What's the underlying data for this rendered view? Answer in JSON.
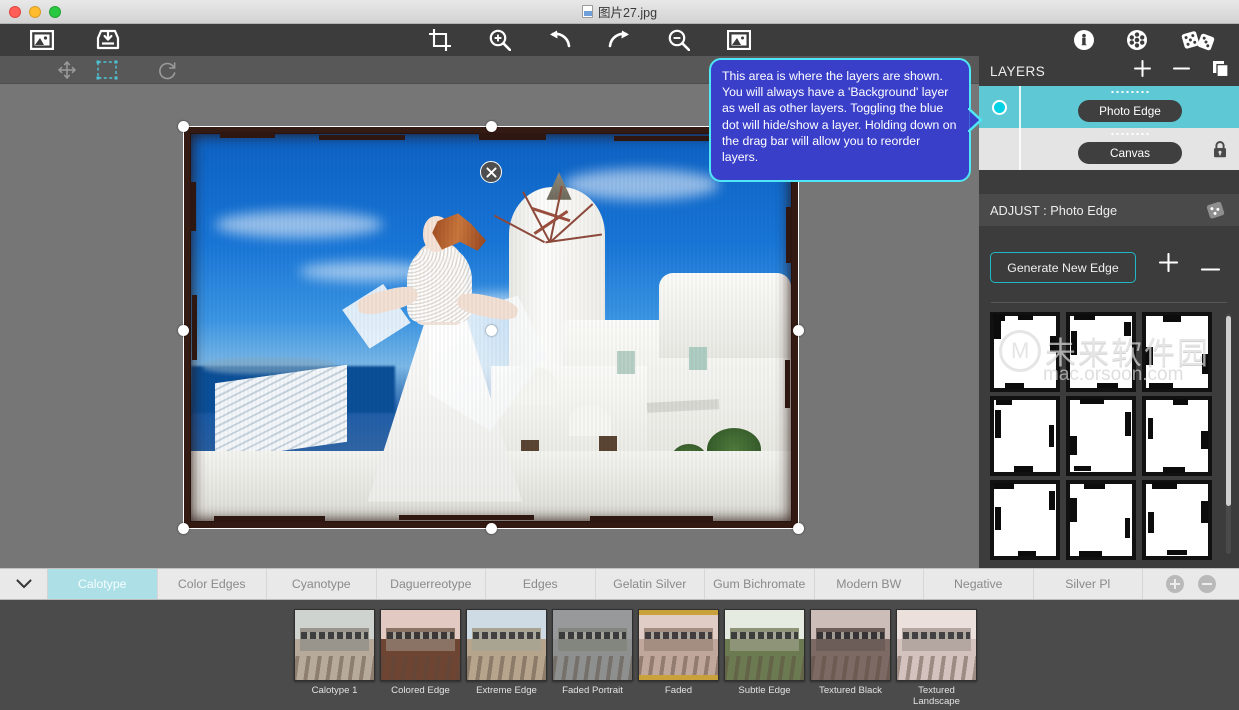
{
  "window": {
    "title": "图片27.jpg",
    "traffic_lights": [
      "close",
      "minimize",
      "zoom"
    ]
  },
  "toolbar": {
    "left_items": [
      {
        "name": "image-icon",
        "label": "Image"
      },
      {
        "name": "import-icon",
        "label": "Import"
      }
    ],
    "center_items": [
      {
        "name": "crop-icon",
        "label": "Crop"
      },
      {
        "name": "zoom-in-icon",
        "label": "Zoom In"
      },
      {
        "name": "undo-icon",
        "label": "Undo"
      },
      {
        "name": "redo-icon",
        "label": "Redo"
      },
      {
        "name": "zoom-out-icon",
        "label": "Zoom Out"
      },
      {
        "name": "fit-image-icon",
        "label": "Fit Image"
      }
    ],
    "right_items": [
      {
        "name": "info-icon",
        "label": "Info"
      },
      {
        "name": "settings-icon",
        "label": "Settings"
      },
      {
        "name": "dice-icon",
        "label": "Randomize"
      }
    ]
  },
  "toolbar2": {
    "items": [
      {
        "name": "move-tool",
        "label": "Move",
        "active": false
      },
      {
        "name": "select-tool",
        "label": "Select",
        "active": true
      },
      {
        "name": "reset-tool",
        "label": "Reset",
        "active": false
      }
    ]
  },
  "canvas": {
    "close_label": "×",
    "selection_handles": 8
  },
  "tooltip": {
    "text": "This area is where the layers are shown. You will always have a 'Background' layer as well as other layers. Toggling the blue dot will hide/show a layer. Holding down on the drag bar will allow you to reorder layers.",
    "background_color": "#3a3fca",
    "border_color": "#4fe6f5"
  },
  "layers_panel": {
    "title": "LAYERS",
    "add_label": "+",
    "remove_label": "−",
    "duplicate_label": "Duplicate",
    "items": [
      {
        "name": "Photo Edge",
        "selected": true,
        "visible": true,
        "locked": false
      },
      {
        "name": "Canvas",
        "selected": false,
        "visible": false,
        "locked": true
      }
    ]
  },
  "adjust_panel": {
    "title": "ADJUST : Photo Edge",
    "generate_label": "Generate New Edge",
    "add_label": "+",
    "remove_label": "−",
    "thumbnail_count": 12
  },
  "watermark": {
    "cn": "未来软件园",
    "en": "mac.orsoon.com"
  },
  "tabs": {
    "collapse_icon": "chevron-down-icon",
    "items": [
      {
        "label": "Calotype",
        "active": true
      },
      {
        "label": "Color Edges",
        "active": false
      },
      {
        "label": "Cyanotype",
        "active": false
      },
      {
        "label": "Daguerreotype",
        "active": false
      },
      {
        "label": "Edges",
        "active": false
      },
      {
        "label": "Gelatin Silver",
        "active": false
      },
      {
        "label": "Gum Bichromate",
        "active": false
      },
      {
        "label": "Modern BW",
        "active": false
      },
      {
        "label": "Negative",
        "active": false
      },
      {
        "label": "Silver Pl",
        "active": false
      }
    ],
    "add_label": "+",
    "remove_label": "−"
  },
  "presets": [
    {
      "label": "Calotype 1",
      "sky": "#cfd3cf",
      "ground": "#b7aa9b",
      "car": "#9a958c"
    },
    {
      "label": "Colored Edge",
      "sky": "#e2c9c2",
      "ground": "#6e4433",
      "car": "#8a7264"
    },
    {
      "label": "Extreme Edge",
      "sky": "#cfdbe4",
      "ground": "#b6a58c",
      "car": "#a9a392"
    },
    {
      "label": "Faded Portrait",
      "sky": "#97999a",
      "ground": "#8e9090",
      "car": "#83857f"
    },
    {
      "label": "Faded",
      "sky": "#e0cdc6",
      "ground": "#c0a79c",
      "car": "#a48e82"
    },
    {
      "label": "Subtle Edge",
      "sky": "#e6ebe2",
      "ground": "#6c7a52",
      "car": "#8d9478"
    },
    {
      "label": "Textured Black",
      "sky": "#cdbdb8",
      "ground": "#7d6a64",
      "car": "#6d5d58"
    },
    {
      "label": "Textured Landscape",
      "sky": "#ece0dd",
      "ground": "#d3c2bd",
      "car": "#b4a6a1"
    }
  ]
}
